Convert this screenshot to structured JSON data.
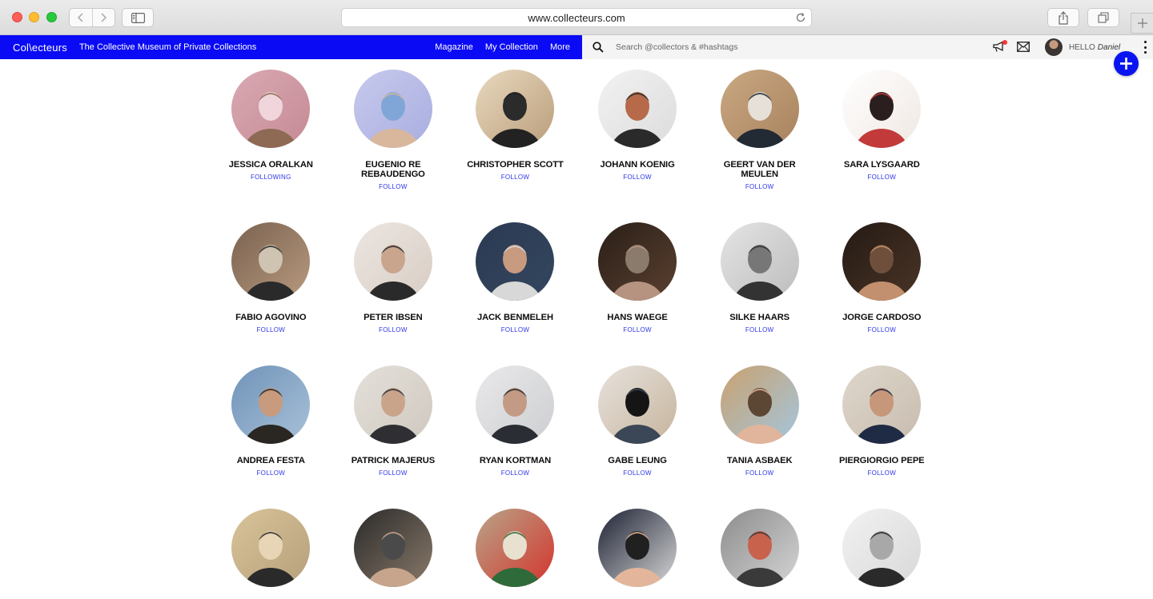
{
  "browser": {
    "url": "www.collecteurs.com"
  },
  "site": {
    "logo": "Col\\ecteurs",
    "tagline": "The Collective Museum of Private Collections",
    "brand_color": "#0a0af5",
    "nav": [
      "Magazine",
      "My Collection",
      "More"
    ],
    "search_placeholder": "Search @collectors & #hashtags",
    "hello_label": "HELLO",
    "user_name": "Daniel"
  },
  "collectors": [
    [
      {
        "name": "JESSICA ORALKAN",
        "status": "FOLLOWING",
        "palette": [
          "#d9a9b3",
          "#c58a94",
          "#8e6a55",
          "#f0d6dc"
        ]
      },
      {
        "name": "EUGENIO RE REBAUDENGO",
        "status": "FOLLOW",
        "palette": [
          "#c7c9ec",
          "#a9aee0",
          "#d8b79d",
          "#7fa6d6"
        ]
      },
      {
        "name": "CHRISTOPHER SCOTT",
        "status": "FOLLOW",
        "palette": [
          "#e9d9bf",
          "#b99d7a",
          "#222222",
          "#2b2b2b"
        ]
      },
      {
        "name": "JOHANN KOENIG",
        "status": "FOLLOW",
        "palette": [
          "#f2f2f2",
          "#dcdcdc",
          "#2a2a2a",
          "#b66a4a"
        ]
      },
      {
        "name": "GEERT VAN DER MEULEN",
        "status": "FOLLOW",
        "palette": [
          "#c9a882",
          "#a8825e",
          "#222a33",
          "#e6e0d8"
        ]
      },
      {
        "name": "SARA LYSGAARD",
        "status": "FOLLOW",
        "palette": [
          "#ffffff",
          "#f0e8e3",
          "#c23a3a",
          "#2a1e1e"
        ]
      }
    ],
    [
      {
        "name": "FABIO AGOVINO",
        "status": "FOLLOW",
        "palette": [
          "#7a6250",
          "#b89a7e",
          "#2a2a2a",
          "#cfc3b2"
        ]
      },
      {
        "name": "PETER IBSEN",
        "status": "FOLLOW",
        "palette": [
          "#ece6e1",
          "#d8cdc4",
          "#2a2a2a",
          "#c9a58e"
        ]
      },
      {
        "name": "JACK BENMELEH",
        "status": "FOLLOW",
        "palette": [
          "#2b3a52",
          "#34465f",
          "#d8d8d8",
          "#c89a80"
        ]
      },
      {
        "name": "HANS WAEGE",
        "status": "FOLLOW",
        "palette": [
          "#2a1f18",
          "#5a4030",
          "#b59380",
          "#8b7b6d"
        ]
      },
      {
        "name": "SILKE HAARS",
        "status": "FOLLOW",
        "palette": [
          "#e4e4e4",
          "#bdbdbd",
          "#333333",
          "#777777"
        ]
      },
      {
        "name": "JORGE CARDOSO",
        "status": "FOLLOW",
        "palette": [
          "#241a14",
          "#4a3426",
          "#c2906e",
          "#6e4f3b"
        ]
      }
    ],
    [
      {
        "name": "ANDREA FESTA",
        "status": "FOLLOW",
        "palette": [
          "#6f93b8",
          "#a9c1d8",
          "#2a2622",
          "#c89a7e"
        ]
      },
      {
        "name": "PATRICK MAJERUS",
        "status": "FOLLOW",
        "palette": [
          "#e4e0da",
          "#cfc8bf",
          "#2e2e33",
          "#c9a48b"
        ]
      },
      {
        "name": "RYAN KORTMAN",
        "status": "FOLLOW",
        "palette": [
          "#e9e9ea",
          "#cdced1",
          "#2a2d33",
          "#c39a84"
        ]
      },
      {
        "name": "GABE LEUNG",
        "status": "FOLLOW",
        "palette": [
          "#e7e2dd",
          "#c6b49c",
          "#3b4656",
          "#151515"
        ]
      },
      {
        "name": "TANIA ASBAEK",
        "status": "FOLLOW",
        "palette": [
          "#c9a16f",
          "#a4c6de",
          "#e0b59c",
          "#5c4634"
        ]
      },
      {
        "name": "PIERGIORGIO PEPE",
        "status": "FOLLOW",
        "palette": [
          "#ded7cc",
          "#c8bcae",
          "#1f2a44",
          "#c7977a"
        ]
      }
    ],
    [
      {
        "name": "",
        "status": "",
        "palette": [
          "#d9c39a",
          "#b5a07a",
          "#2a2a2a",
          "#e8d5b5"
        ]
      },
      {
        "name": "",
        "status": "",
        "palette": [
          "#2a2a2a",
          "#8a7a6a",
          "#c7a58c",
          "#4a4a4a"
        ]
      },
      {
        "name": "",
        "status": "",
        "palette": [
          "#b8a58a",
          "#d4332b",
          "#2f6b3a",
          "#e8e1d0"
        ]
      },
      {
        "name": "",
        "status": "",
        "palette": [
          "#1c2133",
          "#d8d8d8",
          "#e3b69b",
          "#202020"
        ]
      },
      {
        "name": "",
        "status": "",
        "palette": [
          "#8c8c8c",
          "#d5d5d5",
          "#3a3a3a",
          "#c8624d"
        ]
      },
      {
        "name": "",
        "status": "",
        "palette": [
          "#f2f2f2",
          "#d8d8d8",
          "#2a2a2a",
          "#a8a8a8"
        ]
      }
    ]
  ]
}
